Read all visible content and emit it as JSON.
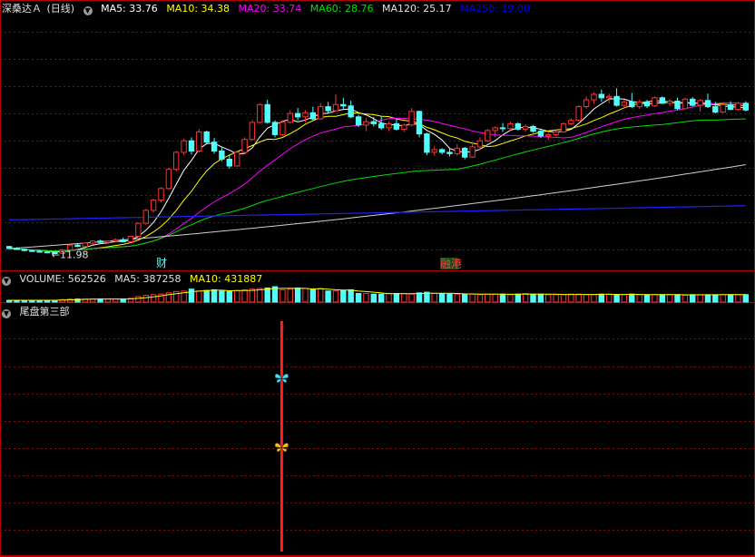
{
  "header": {
    "stock_name": "深桑达Ａ",
    "period": "(日线)",
    "ma_labels": [
      {
        "text": "MA5: 33.76",
        "color": "#ffffff"
      },
      {
        "text": "MA10: 34.38",
        "color": "#ffff00"
      },
      {
        "text": "MA20: 33.74",
        "color": "#ff00ff"
      },
      {
        "text": "MA60: 28.76",
        "color": "#00e000"
      },
      {
        "text": "MA120: 25.17",
        "color": "#e0e0e0"
      },
      {
        "text": "MA250: 19.00",
        "color": "#0000ff"
      }
    ]
  },
  "volume_header": {
    "labels": [
      {
        "text": "VOLUME: 562526",
        "color": "#e0e0e0"
      },
      {
        "text": "MA5: 387258",
        "color": "#e0e0e0"
      },
      {
        "text": "MA10: 431887",
        "color": "#ffff00"
      }
    ]
  },
  "indicator_header": {
    "title": "尾盘第三部"
  },
  "icons": {
    "settings": "gear-icon",
    "butterfly_cyan": "butterfly-icon",
    "butterfly_yellow": "butterfly-icon"
  },
  "colors": {
    "up": "#ff3232",
    "down": "#54fcfc",
    "grid": "#801010",
    "border": "#b00000",
    "signal_line": "#ff2020"
  },
  "chart_data": {
    "type": "candlestick",
    "annotations": {
      "low_label": "←11.98",
      "marker_left": "财",
      "marker_right": "融港"
    },
    "ohlc": [
      [
        13.0,
        13.1,
        12.6,
        12.7
      ],
      [
        12.7,
        12.9,
        12.5,
        12.6
      ],
      [
        12.6,
        12.7,
        12.3,
        12.4
      ],
      [
        12.4,
        12.6,
        12.2,
        12.3
      ],
      [
        12.3,
        12.5,
        12.1,
        12.2
      ],
      [
        12.2,
        12.3,
        12.0,
        12.1
      ],
      [
        12.1,
        12.2,
        11.98,
        12.0
      ],
      [
        12.0,
        12.6,
        11.98,
        12.5
      ],
      [
        12.5,
        13.3,
        12.4,
        13.2
      ],
      [
        13.2,
        13.5,
        12.9,
        13.0
      ],
      [
        13.0,
        13.6,
        12.9,
        13.5
      ],
      [
        13.5,
        13.9,
        13.3,
        13.8
      ],
      [
        13.8,
        14.0,
        13.5,
        13.6
      ],
      [
        13.6,
        13.9,
        13.4,
        13.8
      ],
      [
        13.8,
        14.2,
        13.6,
        14.0
      ],
      [
        14.0,
        14.3,
        13.6,
        13.7
      ],
      [
        13.7,
        14.6,
        13.6,
        14.5
      ],
      [
        14.5,
        16.5,
        14.4,
        16.4
      ],
      [
        16.4,
        18.5,
        16.2,
        18.3
      ],
      [
        18.3,
        20.0,
        18.0,
        19.8
      ],
      [
        19.8,
        21.7,
        19.5,
        21.5
      ],
      [
        21.5,
        24.5,
        21.3,
        24.3
      ],
      [
        24.3,
        27.0,
        24.0,
        26.8
      ],
      [
        26.8,
        28.8,
        26.4,
        28.5
      ],
      [
        28.5,
        29.0,
        26.5,
        27.0
      ],
      [
        27.0,
        30.2,
        26.8,
        29.8
      ],
      [
        29.8,
        30.0,
        28.0,
        28.3
      ],
      [
        28.3,
        28.9,
        26.6,
        27.0
      ],
      [
        27.0,
        27.5,
        25.5,
        25.8
      ],
      [
        25.8,
        26.5,
        24.4,
        24.8
      ],
      [
        24.8,
        27.0,
        24.7,
        26.8
      ],
      [
        26.8,
        29.0,
        26.5,
        28.7
      ],
      [
        28.7,
        31.5,
        28.5,
        31.2
      ],
      [
        31.2,
        34.0,
        31.0,
        33.8
      ],
      [
        33.8,
        34.5,
        31.0,
        31.2
      ],
      [
        31.2,
        31.5,
        29.0,
        29.4
      ],
      [
        29.4,
        31.5,
        29.2,
        31.2
      ],
      [
        31.2,
        33.0,
        31.0,
        32.5
      ],
      [
        32.5,
        33.3,
        31.5,
        32.0
      ],
      [
        32.0,
        33.0,
        31.2,
        32.6
      ],
      [
        32.6,
        33.5,
        31.5,
        31.7
      ],
      [
        31.7,
        34.0,
        31.6,
        33.5
      ],
      [
        33.5,
        34.2,
        32.5,
        32.9
      ],
      [
        32.9,
        35.3,
        32.8,
        33.8
      ],
      [
        33.8,
        34.8,
        33.2,
        33.6
      ],
      [
        33.6,
        34.4,
        31.8,
        32.0
      ],
      [
        32.0,
        32.3,
        30.5,
        30.8
      ],
      [
        30.8,
        31.8,
        29.9,
        31.3
      ],
      [
        31.3,
        32.0,
        30.6,
        31.0
      ],
      [
        31.0,
        32.1,
        30.1,
        30.4
      ],
      [
        30.4,
        31.3,
        29.9,
        31.0
      ],
      [
        31.0,
        31.6,
        30.0,
        30.2
      ],
      [
        30.2,
        31.0,
        29.8,
        30.8
      ],
      [
        30.8,
        33.3,
        30.6,
        32.8
      ],
      [
        32.8,
        32.9,
        29.0,
        29.5
      ],
      [
        29.5,
        29.7,
        26.4,
        26.8
      ],
      [
        26.8,
        27.7,
        26.3,
        27.2
      ],
      [
        27.2,
        27.4,
        26.5,
        26.8
      ],
      [
        26.8,
        27.5,
        26.2,
        26.6
      ],
      [
        26.6,
        28.0,
        26.3,
        27.4
      ],
      [
        27.4,
        27.6,
        25.8,
        26.1
      ],
      [
        26.1,
        28.0,
        26.0,
        27.6
      ],
      [
        27.6,
        29.0,
        27.2,
        28.5
      ],
      [
        28.5,
        30.2,
        28.3,
        30.0
      ],
      [
        30.0,
        30.6,
        29.0,
        30.4
      ],
      [
        30.4,
        31.1,
        29.8,
        30.3
      ],
      [
        30.3,
        31.3,
        30.0,
        31.0
      ],
      [
        31.0,
        31.2,
        30.0,
        30.2
      ],
      [
        30.2,
        30.9,
        29.8,
        30.6
      ],
      [
        30.6,
        30.8,
        29.7,
        29.9
      ],
      [
        29.9,
        30.1,
        28.9,
        29.2
      ],
      [
        29.2,
        29.7,
        28.6,
        29.4
      ],
      [
        29.4,
        30.0,
        29.2,
        29.8
      ],
      [
        29.8,
        31.2,
        29.7,
        31.0
      ],
      [
        31.0,
        31.8,
        30.8,
        31.5
      ],
      [
        31.5,
        33.7,
        31.3,
        33.5
      ],
      [
        33.5,
        35.0,
        33.2,
        34.5
      ],
      [
        34.5,
        35.6,
        33.9,
        35.3
      ],
      [
        35.3,
        36.0,
        34.2,
        34.8
      ],
      [
        34.8,
        35.4,
        34.0,
        35.0
      ],
      [
        35.0,
        36.2,
        33.5,
        33.7
      ],
      [
        33.7,
        34.5,
        33.3,
        34.2
      ],
      [
        34.2,
        35.5,
        33.3,
        33.5
      ],
      [
        33.5,
        34.5,
        33.2,
        34.2
      ],
      [
        34.2,
        34.5,
        33.3,
        33.6
      ],
      [
        33.6,
        35.0,
        33.4,
        34.8
      ],
      [
        34.8,
        35.0,
        33.9,
        34.0
      ],
      [
        34.0,
        34.6,
        33.6,
        34.3
      ],
      [
        34.3,
        34.8,
        33.0,
        33.2
      ],
      [
        33.2,
        34.8,
        33.1,
        34.6
      ],
      [
        34.6,
        34.9,
        33.5,
        33.7
      ],
      [
        33.7,
        34.6,
        32.8,
        34.4
      ],
      [
        34.4,
        35.4,
        33.3,
        33.5
      ],
      [
        33.5,
        34.2,
        32.5,
        32.7
      ],
      [
        32.7,
        34.0,
        32.6,
        33.8
      ],
      [
        33.8,
        34.3,
        33.0,
        33.1
      ],
      [
        33.1,
        34.2,
        32.9,
        34.0
      ],
      [
        34.0,
        34.3,
        32.8,
        33.0
      ]
    ],
    "volume": [
      3,
      3,
      3,
      3,
      3,
      3,
      3,
      4,
      5,
      5,
      5,
      5,
      5,
      5,
      5,
      5,
      6,
      9,
      11,
      12,
      13,
      15,
      17,
      18,
      21,
      18,
      19,
      20,
      18,
      17,
      19,
      20,
      21,
      22,
      23,
      25,
      20,
      21,
      23,
      22,
      20,
      22,
      18,
      18,
      19,
      20,
      14,
      14,
      13,
      13,
      14,
      14,
      14,
      13,
      15,
      16,
      14,
      14,
      13,
      13,
      13,
      13,
      12,
      13,
      13,
      13,
      12,
      13,
      14,
      13,
      13,
      12,
      12,
      12,
      13,
      13,
      12,
      12,
      13,
      13,
      12,
      12,
      13,
      12,
      12,
      12,
      12,
      12,
      12,
      11,
      12,
      12,
      12,
      12,
      12,
      12,
      12,
      12
    ],
    "indicator_signals": [
      {
        "index": 36,
        "type": "line"
      },
      {
        "index": 36,
        "type": "butterfly",
        "color": "cyan",
        "level": 0.75
      },
      {
        "index": 36,
        "type": "butterfly",
        "color": "yellow",
        "level": 0.45
      }
    ]
  }
}
